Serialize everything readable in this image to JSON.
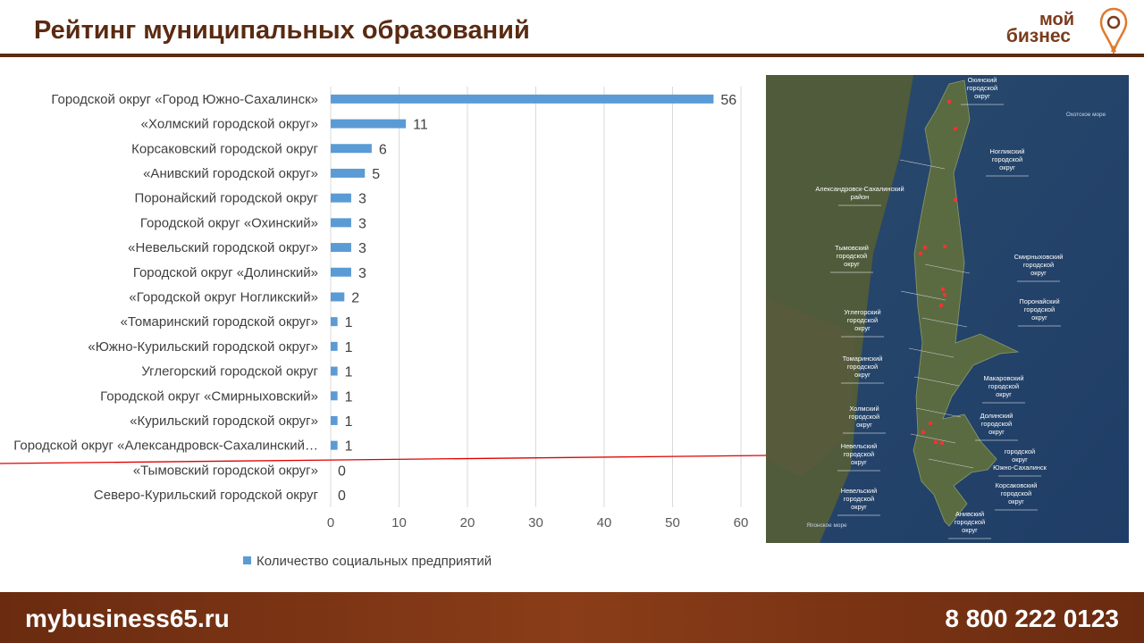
{
  "header": {
    "title": "Рейтинг муниципальных образований",
    "logo": {
      "line1": "мой",
      "line2": "бизнес",
      "icon": "location-pin-icon"
    }
  },
  "footer": {
    "url": "mybusiness65.ru",
    "phone": "8 800 222 0123"
  },
  "colors": {
    "bar": "#5b9bd5",
    "brand": "#5a2a12",
    "cutoff_line": "#e00000"
  },
  "chart_data": {
    "type": "bar",
    "orientation": "horizontal",
    "categories": [
      "Городской округ «Город Южно-Сахалинск»",
      "«Холмский городской округ»",
      "Корсаковский городской округ",
      "«Анивский городской округ»",
      "Поронайский городской округ",
      "Городской округ «Охинский»",
      "«Невельский городской округ»",
      "Городской округ «Долинский»",
      "«Городской округ Ногликский»",
      "«Томаринский городской округ»",
      "«Южно-Курильский городской округ»",
      "Углегорский городской округ",
      "Городской округ «Смирныховский»",
      "«Курильский городской округ»",
      "Городской округ «Александровск-Сахалинский…",
      "«Тымовский городской округ»",
      "Северо-Курильский городской округ"
    ],
    "series": [
      {
        "name": "Количество социальных предприятий",
        "values": [
          56,
          11,
          6,
          5,
          3,
          3,
          3,
          3,
          2,
          1,
          1,
          1,
          1,
          1,
          1,
          0,
          0
        ]
      }
    ],
    "xlim": [
      0,
      60
    ],
    "xticks": [
      0,
      10,
      20,
      30,
      40,
      50,
      60
    ],
    "grid": true,
    "legend": "bottom",
    "data_labels": true
  },
  "map": {
    "sea_labels": [
      "Охотское море",
      "Японское море"
    ],
    "regions": [
      "Охинский городской округ",
      "Ногликский городской округ",
      "Александровск-Сахалинский район",
      "Тымовский городской округ",
      "Смирныховский городской округ",
      "Поронайский городской округ",
      "Углегорский городской округ",
      "Томаринский городской округ",
      "Макаровский городской округ",
      "Холмский городской округ",
      "Долинский городской округ",
      "Невельский городской округ",
      "городской округ Южно-Сахалинск",
      "Невельский городской округ",
      "Корсаковский городской округ",
      "Анивский городской округ"
    ]
  }
}
